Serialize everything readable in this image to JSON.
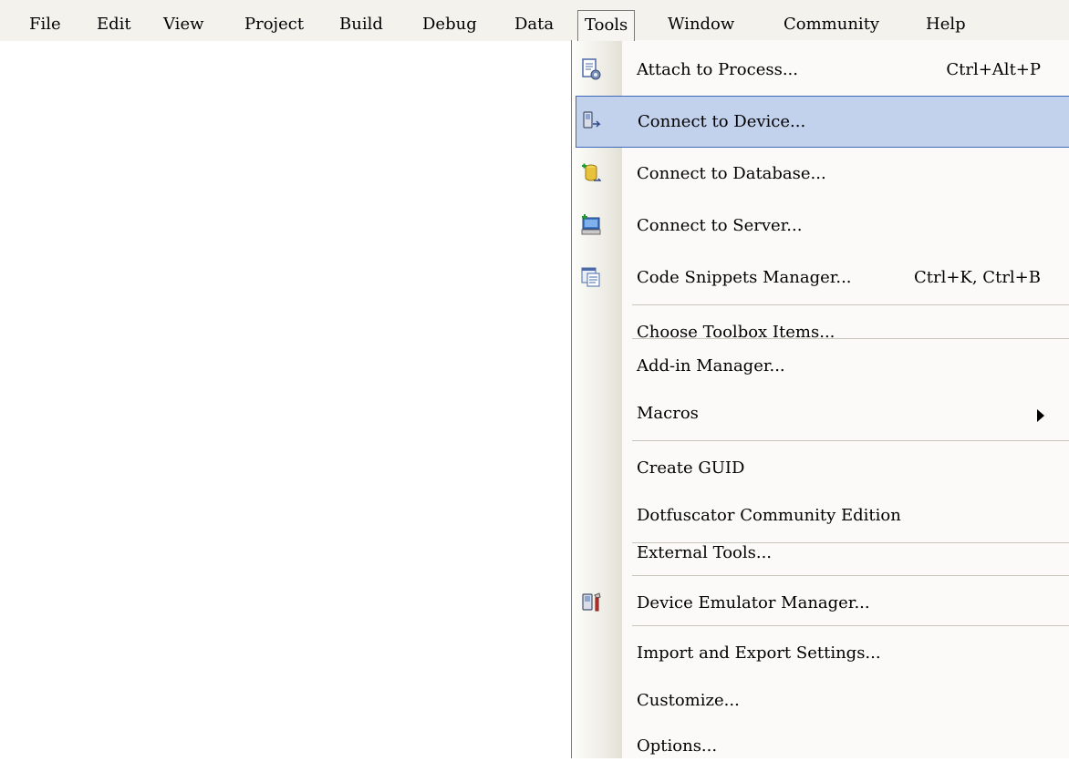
{
  "menubar": {
    "items": [
      {
        "label": "File"
      },
      {
        "label": "Edit"
      },
      {
        "label": "View"
      },
      {
        "label": "Project"
      },
      {
        "label": "Build"
      },
      {
        "label": "Debug"
      },
      {
        "label": "Data"
      },
      {
        "label": "Tools"
      },
      {
        "label": "Window"
      },
      {
        "label": "Community"
      },
      {
        "label": "Help"
      }
    ],
    "open_item": "Tools"
  },
  "tools_menu": {
    "items": [
      {
        "label": "Attach to Process...",
        "shortcut": "Ctrl+Alt+P",
        "icon": "attach-process-icon"
      },
      {
        "label": "Connect to Device...",
        "icon": "connect-device-icon",
        "highlighted": true
      },
      {
        "label": "Connect to Database...",
        "icon": "connect-database-icon"
      },
      {
        "label": "Connect to Server...",
        "icon": "connect-server-icon"
      },
      {
        "label": "Code Snippets Manager...",
        "shortcut": "Ctrl+K, Ctrl+B",
        "icon": "code-snippets-icon"
      },
      {
        "label": "Choose Toolbox Items..."
      },
      {
        "label": "Add-in Manager..."
      },
      {
        "label": "Macros",
        "submenu": true
      },
      {
        "label": "Create GUID"
      },
      {
        "label": "Dotfuscator Community Edition"
      },
      {
        "label": "External Tools..."
      },
      {
        "label": "Device Emulator Manager...",
        "icon": "device-emulator-icon"
      },
      {
        "label": "Import and Export Settings..."
      },
      {
        "label": "Customize..."
      },
      {
        "label": "Options..."
      }
    ]
  },
  "colors": {
    "menubar_bg": "#f3f2ec",
    "highlight_bg": "#c2d1ec",
    "highlight_border": "#3e68b8"
  }
}
